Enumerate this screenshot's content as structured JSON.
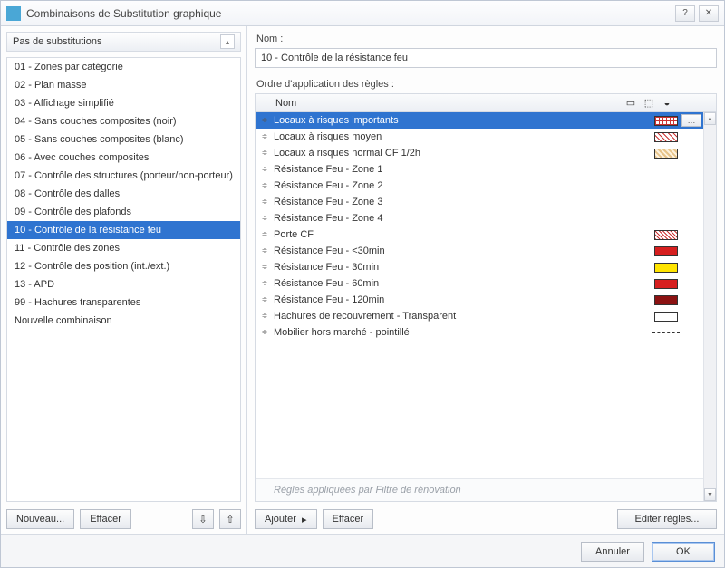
{
  "window": {
    "title": "Combinaisons de Substitution graphique"
  },
  "left": {
    "header": "Pas de substitutions",
    "items": [
      "01 - Zones par catégorie",
      "02 - Plan masse",
      "03 - Affichage simplifié",
      "04 - Sans couches composites (noir)",
      "05 - Sans couches composites (blanc)",
      "06 - Avec couches composites",
      "07 - Contrôle des structures (porteur/non-porteur)",
      "08 - Contrôle des dalles",
      "09 - Contrôle des plafonds",
      "10 - Contrôle de la résistance feu",
      "11 - Contrôle des zones",
      "12 - Contrôle des position (int./ext.)",
      "13 - APD",
      "99 - Hachures transparentes",
      "Nouvelle combinaison"
    ],
    "selected_index": 9,
    "btn_new": "Nouveau...",
    "btn_delete": "Effacer"
  },
  "right": {
    "name_label": "Nom :",
    "name_value": "10 - Contrôle de la résistance feu",
    "order_label": "Ordre d'application des règles :",
    "header_col_name": "Nom",
    "rules": [
      {
        "name": "Locaux à risques importants",
        "swatch": "sw-grid",
        "ellipsis": true,
        "selected": true
      },
      {
        "name": "Locaux à risques moyen",
        "swatch": "sw-diag1"
      },
      {
        "name": "Locaux à risques normal CF 1/2h",
        "swatch": "sw-diag2"
      },
      {
        "name": "Résistance Feu - Zone 1"
      },
      {
        "name": "Résistance Feu - Zone 2"
      },
      {
        "name": "Résistance Feu - Zone 3"
      },
      {
        "name": "Résistance Feu - Zone 4"
      },
      {
        "name": "Porte CF",
        "swatch": "sw-diag3"
      },
      {
        "name": "Résistance Feu - <30min",
        "swatch": "sw-red"
      },
      {
        "name": "Résistance Feu - 30min",
        "swatch": "sw-yellow"
      },
      {
        "name": "Résistance Feu - 60min",
        "swatch": "sw-red"
      },
      {
        "name": "Résistance Feu - 120min",
        "swatch": "sw-darkred"
      },
      {
        "name": "Hachures de recouvrement - Transparent",
        "swatch": "sw-white"
      },
      {
        "name": "Mobilier hors marché - pointillé",
        "dash": true
      }
    ],
    "renovation_note": "Règles appliquées par Filtre de rénovation",
    "btn_add": "Ajouter",
    "btn_clear": "Effacer",
    "btn_edit": "Editer règles..."
  },
  "footer": {
    "cancel": "Annuler",
    "ok": "OK"
  }
}
